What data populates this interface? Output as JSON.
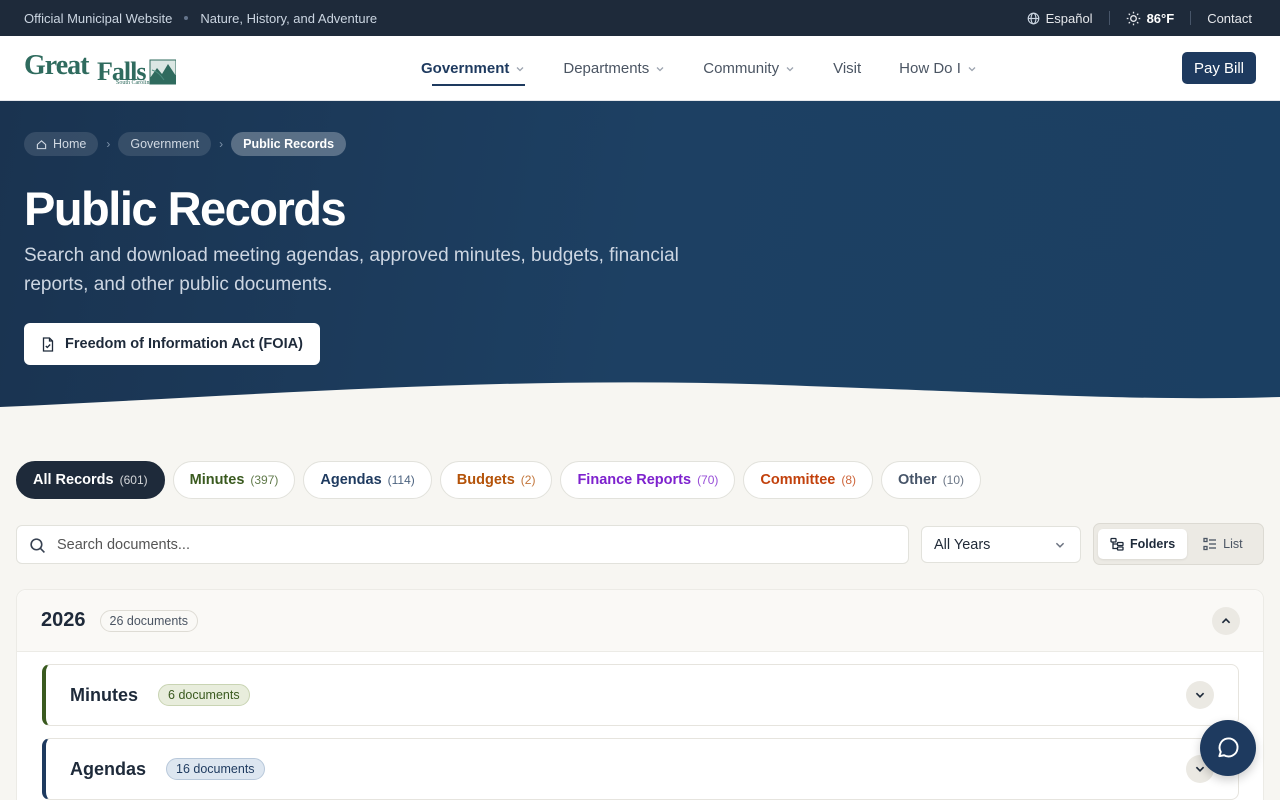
{
  "utility": {
    "official": "Official Municipal Website",
    "tagline": "Nature, History, and Adventure",
    "language": "Español",
    "temperature": "86°F",
    "contact": "Contact"
  },
  "nav": {
    "logo_text": "GreatFalls",
    "logo_sub": "South Carolina",
    "items": [
      {
        "label": "Government",
        "dropdown": true,
        "active": true
      },
      {
        "label": "Departments",
        "dropdown": true
      },
      {
        "label": "Community",
        "dropdown": true
      },
      {
        "label": "Visit",
        "dropdown": false
      },
      {
        "label": "How Do I",
        "dropdown": true
      }
    ],
    "pay_bill": "Pay Bill"
  },
  "breadcrumb": [
    "Home",
    "Government",
    "Public Records"
  ],
  "hero": {
    "title": "Public Records",
    "subtitle": "Search and download meeting agendas, approved minutes, budgets, financial reports, and other public documents.",
    "foia_button": "Freedom of Information Act (FOIA)"
  },
  "filters": [
    {
      "label": "All Records",
      "count": "(601)",
      "color": "#ffffff"
    },
    {
      "label": "Minutes",
      "count": "(397)",
      "color": "#3a5a1f"
    },
    {
      "label": "Agendas",
      "count": "(114)",
      "color": "#1e3a5f"
    },
    {
      "label": "Budgets",
      "count": "(2)",
      "color": "#b45309"
    },
    {
      "label": "Finance Reports",
      "count": "(70)",
      "color": "#7e22ce"
    },
    {
      "label": "Committee",
      "count": "(8)",
      "color": "#c2410c"
    },
    {
      "label": "Other",
      "count": "(10)",
      "color": "#475569"
    }
  ],
  "search": {
    "placeholder": "Search documents..."
  },
  "year_filter": {
    "selected": "All Years"
  },
  "view_toggle": {
    "folders": "Folders",
    "list": "List",
    "active": "Folders"
  },
  "year_group": {
    "year": "2026",
    "count": "26 documents",
    "folders": [
      {
        "name": "Minutes",
        "count": "6 documents",
        "accent": "#3a5a1f",
        "badge_bg": "#e8eddc",
        "badge_color": "#3a5a1f"
      },
      {
        "name": "Agendas",
        "count": "16 documents",
        "accent": "#1e3a5f",
        "badge_bg": "#dde6f0",
        "badge_color": "#1e3a5f"
      }
    ]
  },
  "colors": {
    "primary": "#1e3a5f",
    "dark": "#1e2a3a"
  }
}
